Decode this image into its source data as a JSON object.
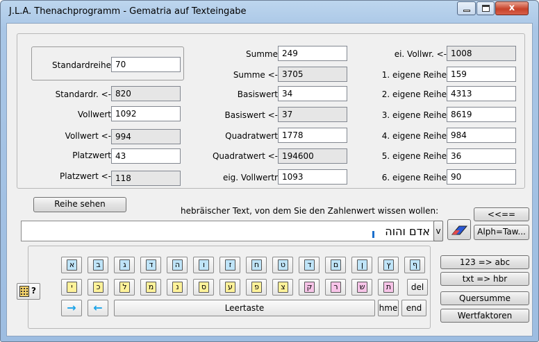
{
  "window": {
    "title": "J.L.A. Thenachprogramm - Gematria auf Texteingabe",
    "close_glyph": "x"
  },
  "col1": {
    "standardreihe_label": "Standardreihe",
    "standardreihe_value": "70",
    "rows": [
      {
        "label": "Standardr. <-",
        "value": "820",
        "type": "readonly"
      },
      {
        "label": "Vollwert",
        "value": "1092",
        "type": "input"
      },
      {
        "label": "Vollwert <-",
        "value": "994",
        "type": "readonly"
      },
      {
        "label": "Platzwert",
        "value": "43",
        "type": "input"
      },
      {
        "label": "Platzwert <-",
        "value": "118",
        "type": "readonly"
      }
    ]
  },
  "col2": {
    "rows": [
      {
        "label": "Summe",
        "value": "249",
        "type": "input"
      },
      {
        "label": "Summe <-",
        "value": "3705",
        "type": "readonly"
      },
      {
        "label": "Basiswert",
        "value": "34",
        "type": "input"
      },
      {
        "label": "Basiswert <-",
        "value": "37",
        "type": "readonly"
      },
      {
        "label": "Quadratwert",
        "value": "1778",
        "type": "input"
      },
      {
        "label": "Quadratwert <-",
        "value": "194600",
        "type": "readonly"
      },
      {
        "label": "eig. Vollwertr",
        "value": "1093",
        "type": "input"
      }
    ]
  },
  "col3": {
    "rows": [
      {
        "label": "ei. Vollwr. <-",
        "value": "1008",
        "type": "readonly"
      },
      {
        "label": "1. eigene Reihe",
        "value": "159",
        "type": "input"
      },
      {
        "label": "2. eigene Reihe",
        "value": "4313",
        "type": "input"
      },
      {
        "label": "3. eigene Reihe",
        "value": "8619",
        "type": "input"
      },
      {
        "label": "4. eigene Reihe",
        "value": "984",
        "type": "input"
      },
      {
        "label": "5. eigene Reihe",
        "value": "36",
        "type": "input"
      },
      {
        "label": "6. eigene Reihe",
        "value": "90",
        "type": "input"
      }
    ]
  },
  "controls": {
    "reihe_sehen": "Reihe sehen",
    "prompt": "hebräischer Text, von dem Sie den Zahlenwert wissen wollen:",
    "back_button": "<<==",
    "alph_button": "Alph=Taw...",
    "dropdown_letter": "v",
    "hebrew_text": "אדם והוה"
  },
  "keyboard": {
    "row1": [
      "א",
      "ב",
      "ג",
      "ד",
      "ה",
      "ו",
      "ז",
      "ח",
      "ט",
      "ד",
      "ם",
      "ן",
      "ץ",
      "ף"
    ],
    "row1_colors": [
      "blue",
      "blue",
      "blue",
      "blue",
      "blue",
      "blue",
      "blue",
      "blue",
      "blue",
      "blue",
      "blue",
      "blue",
      "blue",
      "blue"
    ],
    "row2": [
      "י",
      "כ",
      "ל",
      "מ",
      "נ",
      "ס",
      "ע",
      "פ",
      "צ",
      "ק",
      "ר",
      "ש",
      "ת"
    ],
    "row2_colors": [
      "yellow",
      "yellow",
      "yellow",
      "yellow",
      "yellow",
      "yellow",
      "yellow",
      "yellow",
      "yellow",
      "pink",
      "pink",
      "pink",
      "pink"
    ],
    "del": "del",
    "space": "Leertaste",
    "hme": "hme",
    "end": "end",
    "right_arrow": "→",
    "left_arrow": "←",
    "help_mark": "?"
  },
  "side_buttons": [
    "123 => abc",
    "txt => hbr",
    "Quersumme",
    "Wertfaktoren"
  ]
}
